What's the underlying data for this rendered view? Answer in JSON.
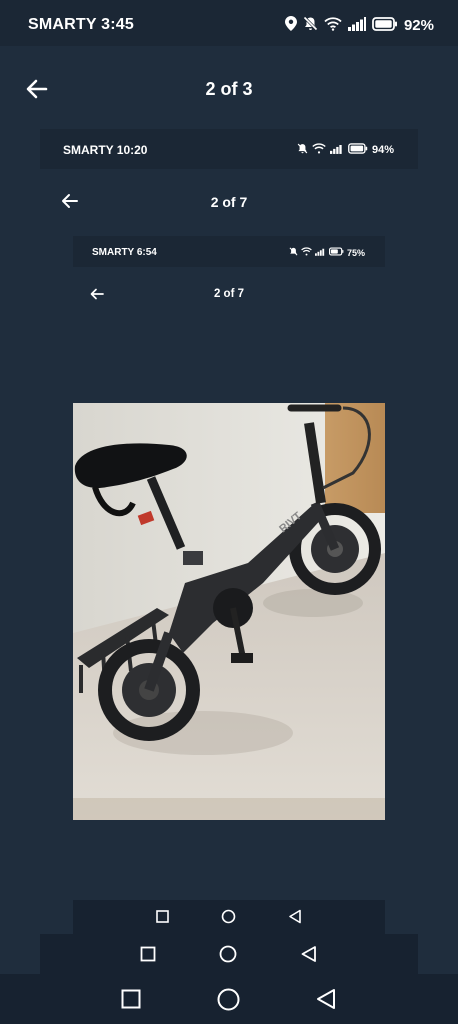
{
  "status_bar": {
    "carrier_time": "SMARTY 3:45",
    "battery": "92%"
  },
  "viewer": {
    "counter": "2 of 3"
  },
  "nested_screenshot_1": {
    "status_bar": {
      "carrier_time": "SMARTY 10:20",
      "battery": "94%"
    },
    "counter": "2 of 7"
  },
  "nested_screenshot_2": {
    "status_bar": {
      "carrier_time": "SMARTY 6:54",
      "battery": "75%"
    },
    "counter": "2 of 7"
  },
  "photo": {
    "subject": "folding electric bike",
    "frame_text": "RIVT"
  },
  "navigation": {
    "buttons": [
      "recents-icon",
      "home-icon",
      "back-triangle-icon"
    ]
  },
  "icons": {
    "location": "location-icon",
    "mute": "bell-off-icon",
    "wifi": "wifi-icon",
    "signal": "signal-icon",
    "battery": "battery-icon",
    "back": "arrow-left-icon"
  }
}
